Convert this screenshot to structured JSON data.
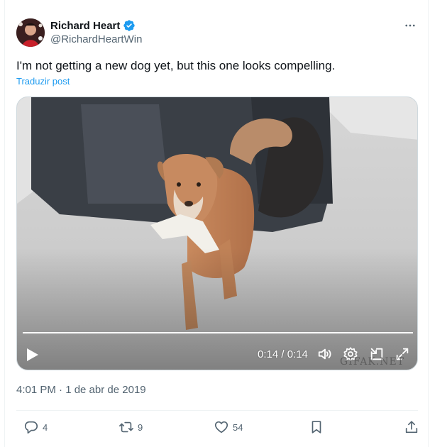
{
  "author": {
    "display_name": "Richard Heart",
    "handle": "@RichardHeartWin",
    "verified": true,
    "avatar": "avatar-photo"
  },
  "tweet": {
    "text": "I'm not getting a new dog yet, but this one looks compelling.",
    "translate_label": "Traduzir post",
    "timestamp": "4:01 PM · 1 de abr de 2019"
  },
  "video": {
    "time_display": "0:14 / 0:14",
    "progress": 1.0,
    "watermark": "GIFAK.NET",
    "controls": [
      "play-icon",
      "volume-icon",
      "settings-icon",
      "dock-icon",
      "fullscreen-icon"
    ]
  },
  "actions": {
    "replies": "4",
    "reposts": "9",
    "likes": "54"
  },
  "colors": {
    "accent": "#1d9bf0",
    "secondary_text": "#536471",
    "primary_text": "#0f1419",
    "divider": "#eff3f4"
  }
}
